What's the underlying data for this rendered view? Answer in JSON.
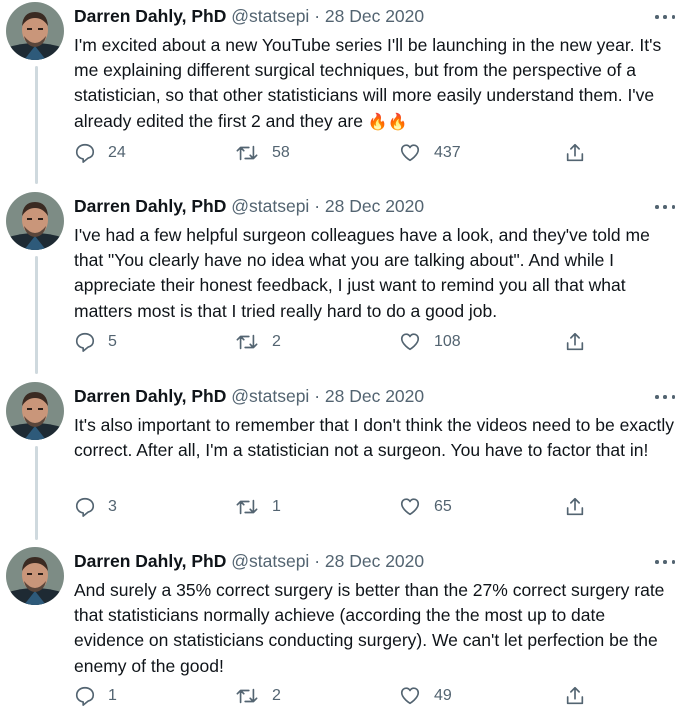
{
  "tweets": [
    {
      "name": "Darren Dahly, PhD",
      "handle": "@statsepi",
      "separator": "·",
      "date": "28 Dec 2020",
      "text": "I'm excited about a new YouTube series I'll be launching in the new year. It's me explaining different surgical techniques, but from the perspective of a statistician, so that other statisticians will more easily understand them. I've already edited the first 2 and they are",
      "emoji": "🔥🔥",
      "replies": "24",
      "retweets": "58",
      "likes": "437"
    },
    {
      "name": "Darren Dahly, PhD",
      "handle": "@statsepi",
      "separator": "·",
      "date": "28 Dec 2020",
      "text": "I've had a few helpful surgeon colleagues have a look, and they've told me that \"You clearly have no idea what you are talking about\". And while I appreciate their honest feedback, I just want to remind you all that what matters most is that I tried really hard to do a good job.",
      "emoji": "",
      "replies": "5",
      "retweets": "2",
      "likes": "108"
    },
    {
      "name": "Darren Dahly, PhD",
      "handle": "@statsepi",
      "separator": "·",
      "date": "28 Dec 2020",
      "text": "It's also important to remember that I don't think the videos need to be exactly correct. After all, I'm a statistician not a surgeon. You have to factor that in!",
      "emoji": "",
      "replies": "3",
      "retweets": "1",
      "likes": "65"
    },
    {
      "name": "Darren Dahly, PhD",
      "handle": "@statsepi",
      "separator": "·",
      "date": "28 Dec 2020",
      "text": "And surely a 35% correct surgery is better than the 27% correct surgery rate that statisticians normally achieve (according the the most up to date evidence on statisticians conducting surgery). We can't let perfection be the enemy of the good!",
      "emoji": "",
      "replies": "1",
      "retweets": "2",
      "likes": "49"
    }
  ],
  "icons": {
    "reply": "reply-icon",
    "retweet": "retweet-icon",
    "like": "like-icon",
    "share": "share-icon",
    "more": "more-icon"
  },
  "colors": {
    "text": "#0f1419",
    "secondary": "#536471",
    "thread_line": "#cfd9de"
  }
}
